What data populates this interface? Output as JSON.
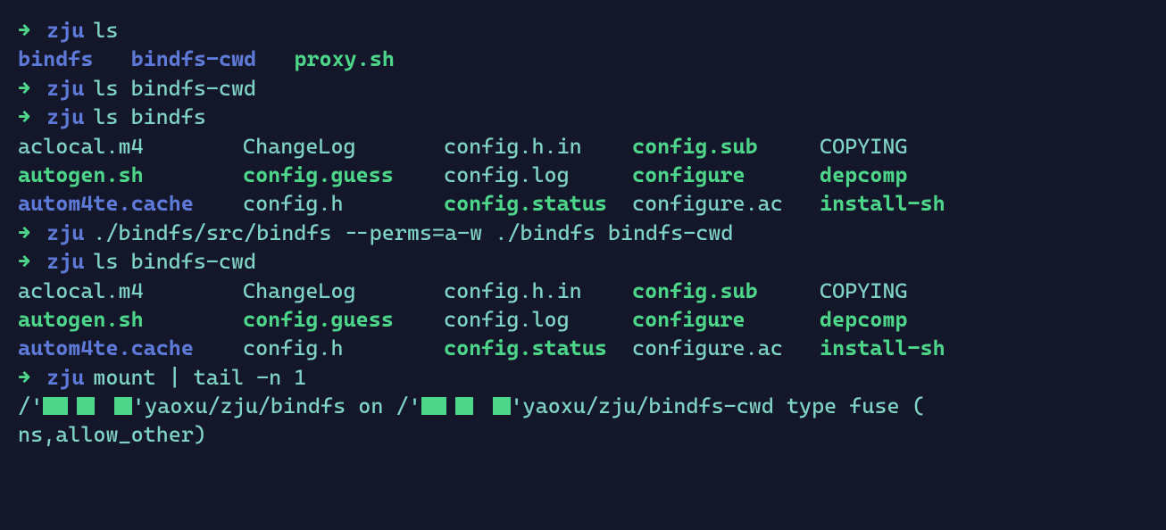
{
  "arrow": "→",
  "cwd": "zju",
  "cmd1": "ls",
  "ls1": {
    "a": "bindfs",
    "b": "bindfs-cwd",
    "c": "proxy.sh"
  },
  "cmd2": "ls bindfs-cwd",
  "cmd3": "ls bindfs",
  "listing": {
    "r1": {
      "c1": "aclocal.m4",
      "c2": "ChangeLog",
      "c3": "config.h.in",
      "c4": "config.sub",
      "c5": "COPYING"
    },
    "r2": {
      "c1": "autogen.sh",
      "c2": "config.guess",
      "c3": "config.log",
      "c4": "configure",
      "c5": "depcomp"
    },
    "r3": {
      "c1": "autom4te.cache",
      "c2": "config.h",
      "c3": "config.status",
      "c4": "configure.ac",
      "c5": "install-sh"
    }
  },
  "cmd4": "./bindfs/src/bindfs --perms=a-w ./bindfs bindfs-cwd",
  "cmd5": "ls bindfs-cwd",
  "cmd6": "mount | tail -n 1",
  "mount": {
    "slash": "/",
    "apos1": "'",
    "part1": "yaoxu/zju/bindfs on /",
    "apos2": "'",
    "part2": "yaoxu/zju/bindfs-cwd type fuse (",
    "cont": "ns,allow_other)"
  }
}
